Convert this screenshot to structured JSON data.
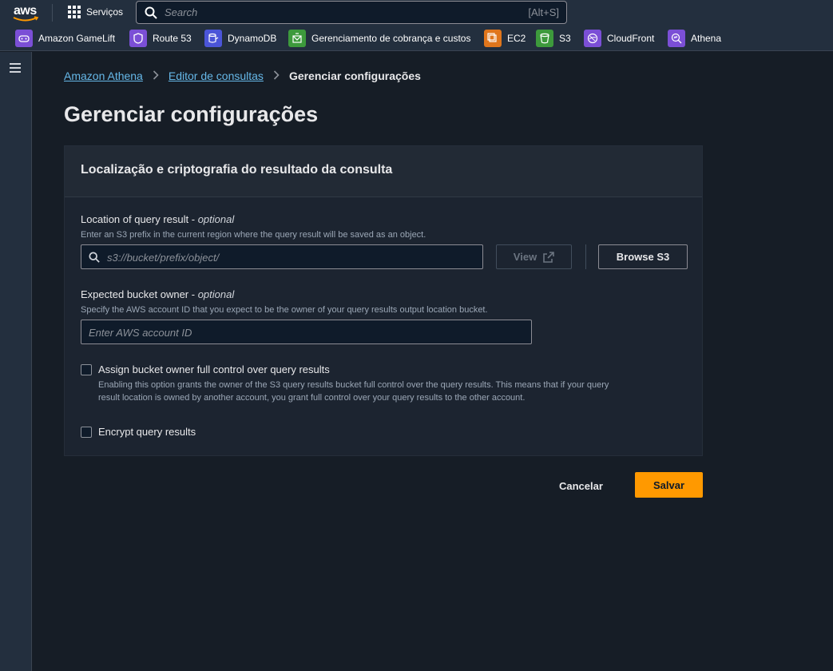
{
  "topbar": {
    "logo_text": "aws",
    "services_label": "Serviços",
    "search": {
      "placeholder": "Search",
      "shortcut": "[Alt+S]"
    }
  },
  "favorites": [
    {
      "label": "Amazon GameLift",
      "color": "#7b4fd6"
    },
    {
      "label": "Route 53",
      "color": "#7b4fd6"
    },
    {
      "label": "DynamoDB",
      "color": "#4b55d8"
    },
    {
      "label": "Gerenciamento de cobrança e custos",
      "color": "#3d9a3c"
    },
    {
      "label": "EC2",
      "color": "#e0761c"
    },
    {
      "label": "S3",
      "color": "#3d9a3c"
    },
    {
      "label": "CloudFront",
      "color": "#7b4fd6"
    },
    {
      "label": "Athena",
      "color": "#7b4fd6"
    }
  ],
  "breadcrumb": {
    "items": [
      "Amazon Athena",
      "Editor de consultas"
    ],
    "current": "Gerenciar configurações"
  },
  "page_title": "Gerenciar configurações",
  "panel": {
    "title": "Localização e criptografia do resultado da consulta",
    "location": {
      "label": "Location of query result - ",
      "optional": "optional",
      "description": "Enter an S3 prefix in the current region where the query result will be saved as an object.",
      "placeholder": "s3://bucket/prefix/object/",
      "view_label": "View",
      "browse_label": "Browse S3"
    },
    "owner": {
      "label": "Expected bucket owner - ",
      "optional": "optional",
      "description": "Specify the AWS account ID that you expect to be the owner of your query results output location bucket.",
      "placeholder": "Enter AWS account ID"
    },
    "assign": {
      "label": "Assign bucket owner full control over query results",
      "description_line1": "Enabling this option grants the owner of the S3 query results bucket full control over the query results. This means that if your query",
      "description_line2": "result location is owned by another account, you grant full control over your query results to the other account."
    },
    "encrypt": {
      "label": "Encrypt query results"
    }
  },
  "actions": {
    "cancel": "Cancelar",
    "save": "Salvar"
  },
  "colors": {
    "accent": "#ff9900",
    "link": "#66b8e8",
    "topbar": "#232f3e",
    "background": "#161d26"
  }
}
